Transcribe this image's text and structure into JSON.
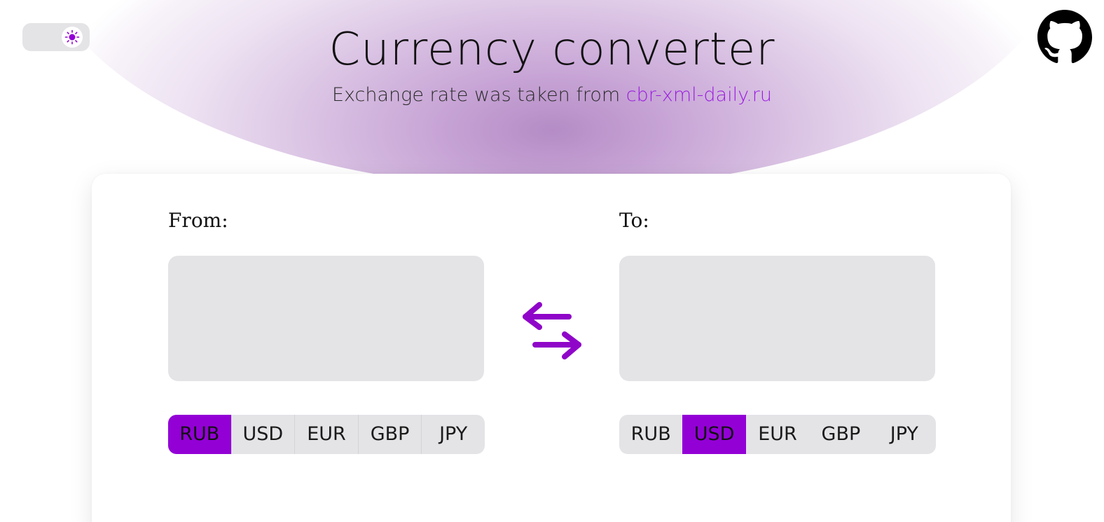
{
  "theme_toggle": {
    "icon": "sun-icon",
    "mode": "light"
  },
  "github": {
    "icon": "github-icon"
  },
  "header": {
    "title": "Currency converter",
    "subtitle_prefix": "Exchange rate was taken from ",
    "source_link": "cbr-xml-daily.ru"
  },
  "converter": {
    "from": {
      "label": "From:",
      "amount": "",
      "currencies": [
        "RUB",
        "USD",
        "EUR",
        "GBP",
        "JPY"
      ],
      "selected": "RUB"
    },
    "swap_icon": "swap-arrows-icon",
    "to": {
      "label": "To:",
      "amount": "",
      "currencies": [
        "RUB",
        "USD",
        "EUR",
        "GBP",
        "JPY"
      ],
      "selected": "USD"
    }
  },
  "colors": {
    "accent": "#9300d6",
    "link": "#9b1de0",
    "input_bg": "#e4e4e7",
    "glow": "#b58cc6"
  }
}
